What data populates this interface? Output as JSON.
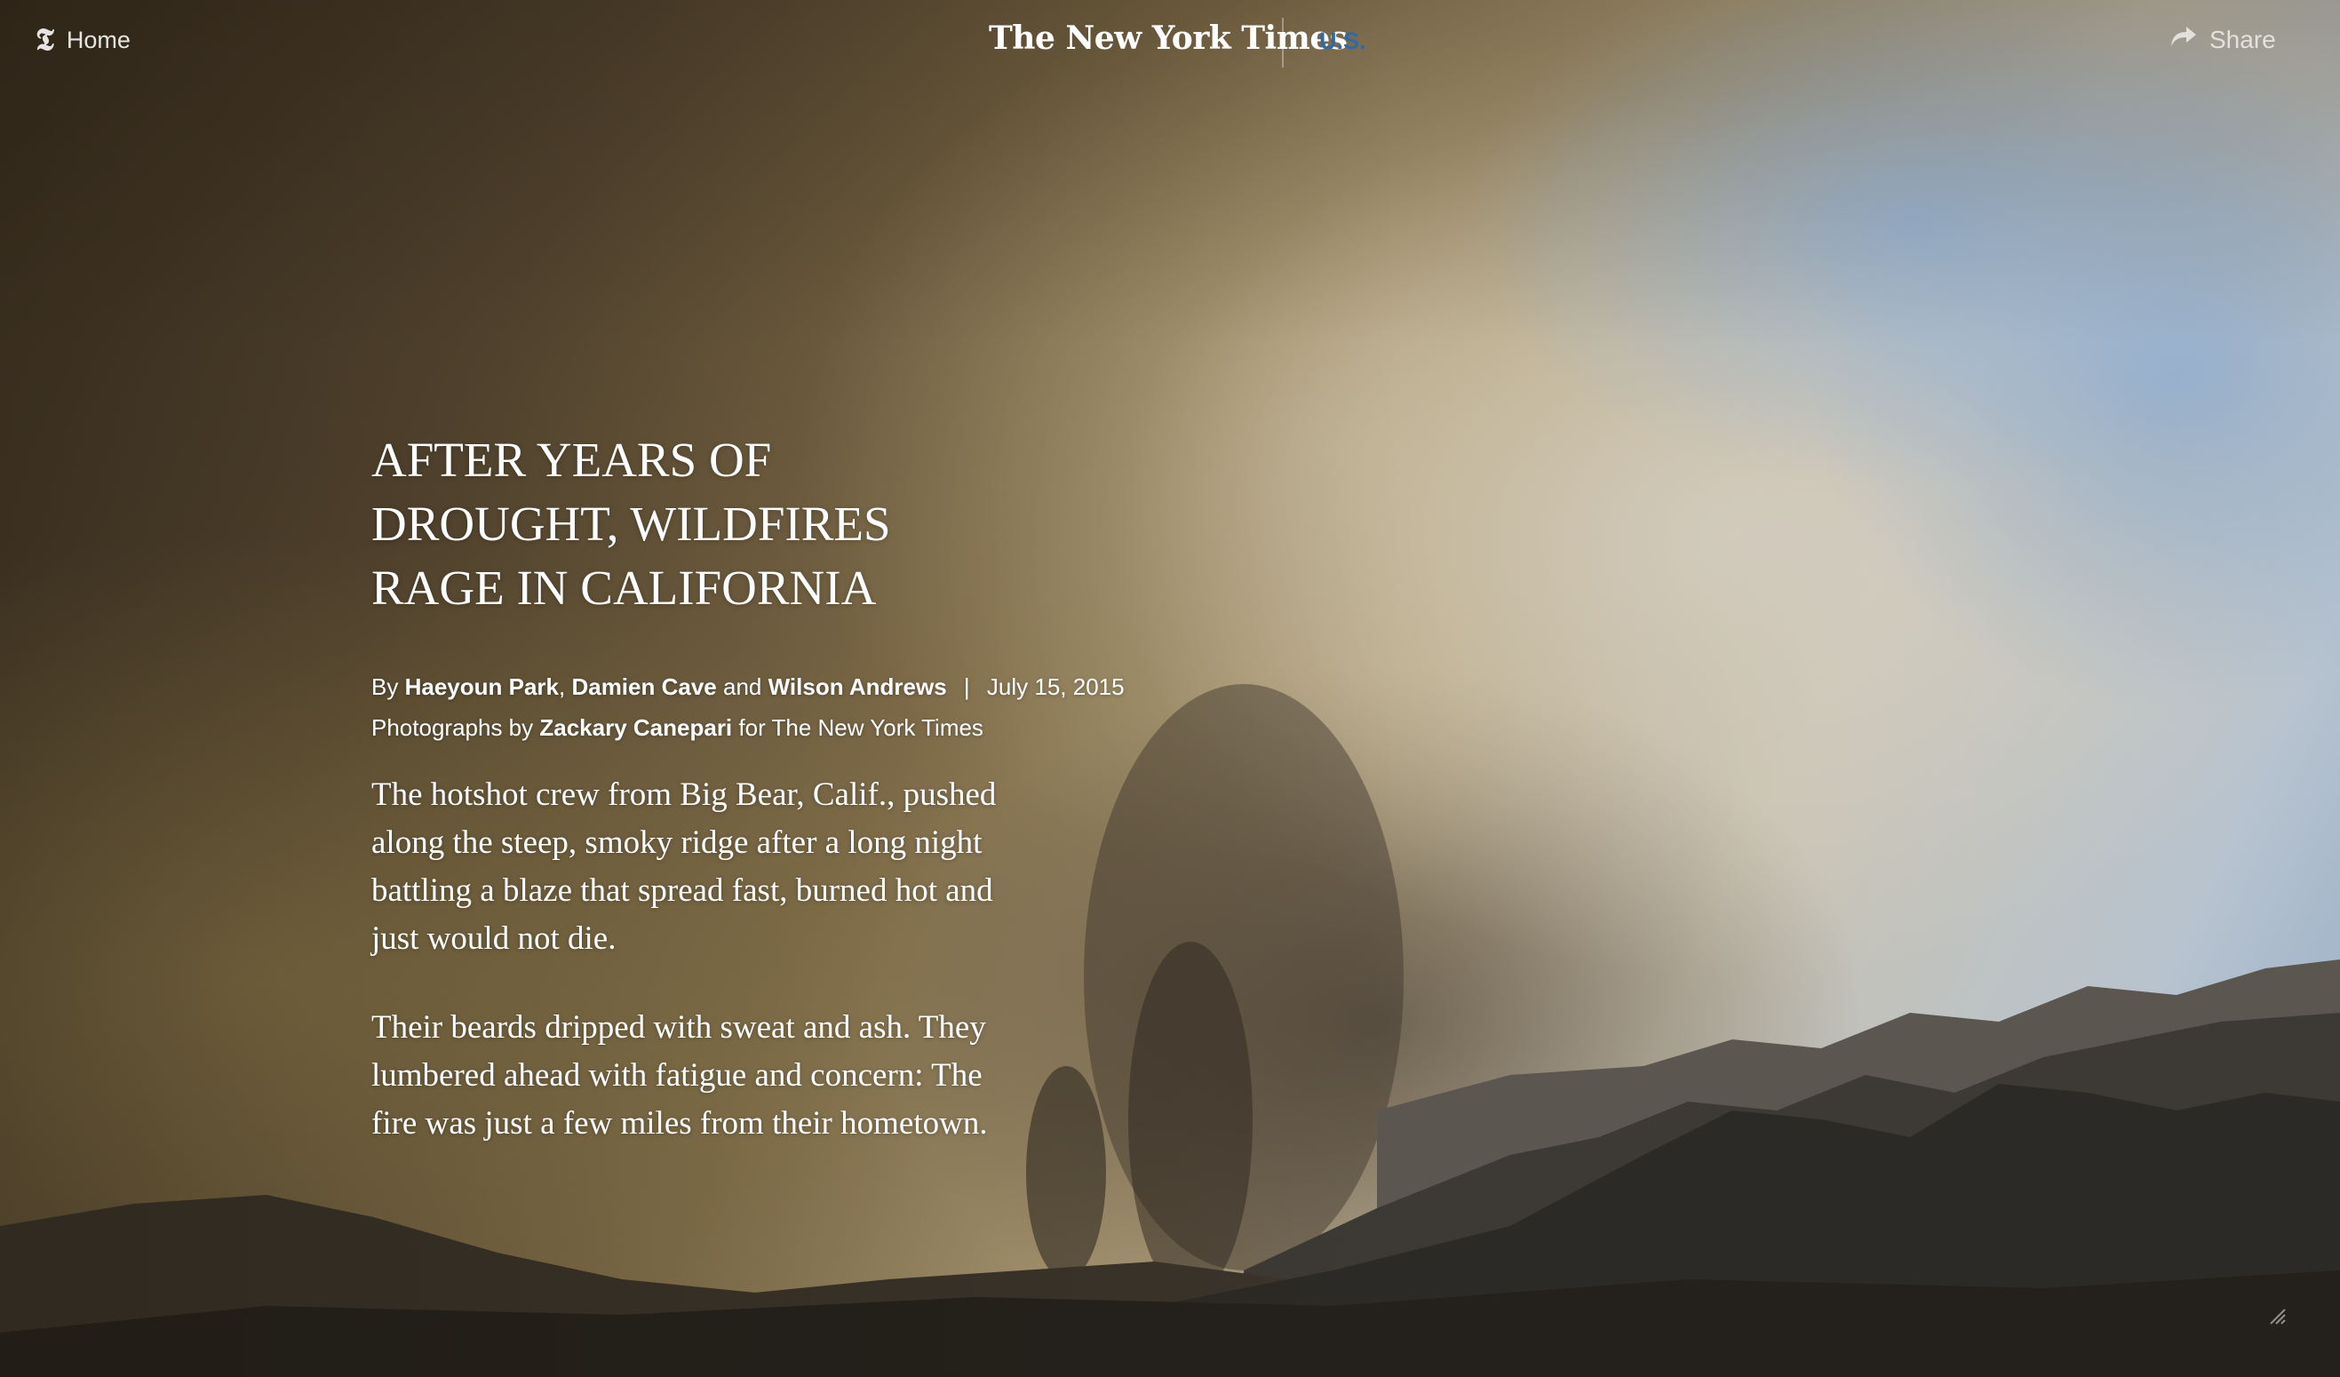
{
  "nav": {
    "home_label": "Home",
    "t_logo": "𝕿",
    "masthead": "The New York Times",
    "section": "U.S.",
    "share_label": "Share",
    "icons": {
      "home": "t-logo-icon",
      "share": "share-arrow-icon"
    }
  },
  "article": {
    "headline_lines": [
      "AFTER YEARS OF",
      "DROUGHT, WILDFIRES",
      "RAGE IN CALIFORNIA"
    ],
    "byline": {
      "by": "By",
      "author1": "Haeyoun Park",
      "comma": ",",
      "author2": "Damien Cave",
      "and": "and",
      "author3": "Wilson Andrews",
      "separator": "|",
      "date": "July 15, 2015"
    },
    "photo_credit": {
      "prefix": "Photographs by",
      "photographer": "Zackary Canepari",
      "suffix": "for The New York Times"
    },
    "paragraphs": [
      "The hotshot crew from Big Bear, Calif., pushed along the steep, smoky ridge after a long night battling a blaze that spread fast, burned hot and just would not die.",
      "Their beards dripped with sweat and ash. They lumbered ahead with fatigue and concern: The fire was just a few miles from their hometown."
    ]
  },
  "colors": {
    "section_link": "#2e6aa6",
    "text": "#ffffff"
  }
}
